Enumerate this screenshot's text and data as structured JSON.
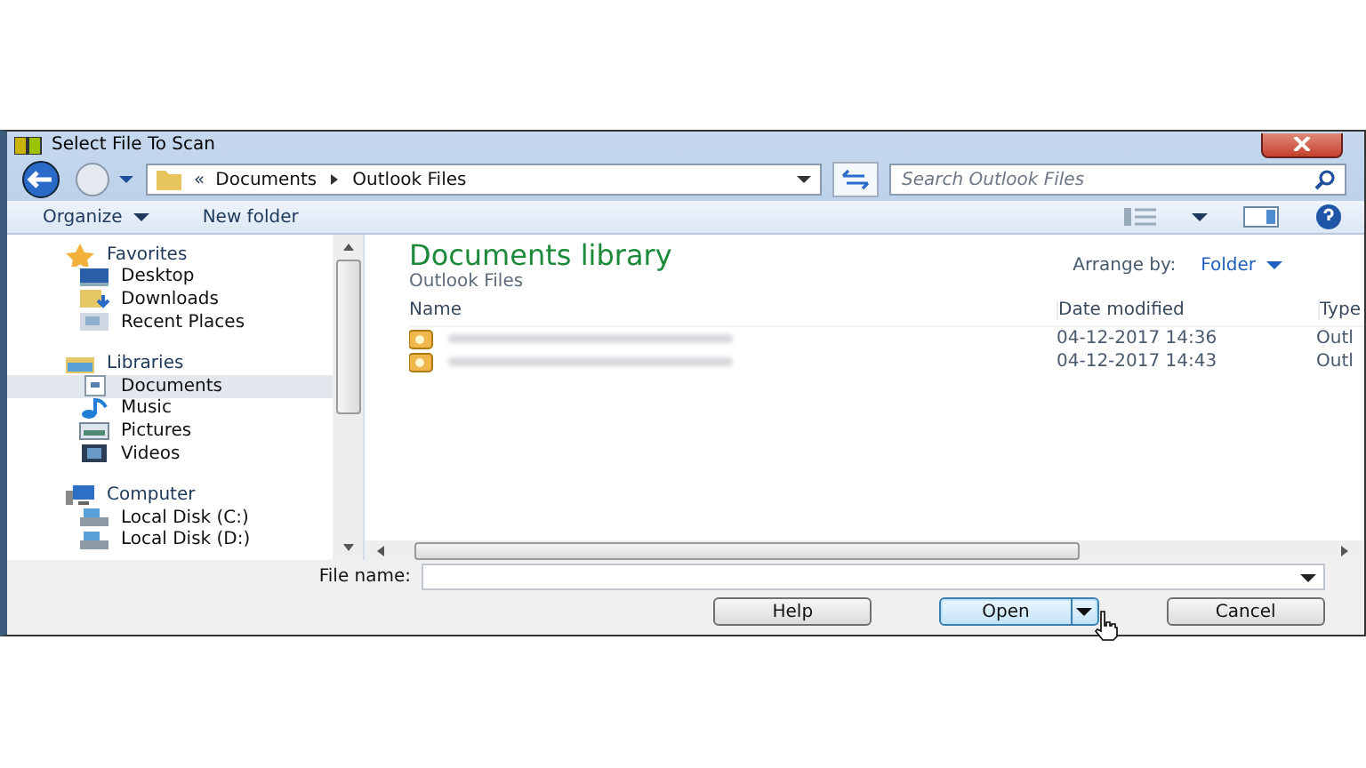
{
  "window": {
    "title": "Select File To Scan"
  },
  "address_bar": {
    "overflow": "«",
    "path": [
      {
        "label": "Documents"
      },
      {
        "label": "Outlook Files"
      }
    ]
  },
  "search": {
    "placeholder": "Search Outlook Files"
  },
  "toolbar": {
    "buttons": [
      {
        "label": "Organize",
        "kind": "menu"
      },
      {
        "label": "New folder",
        "kind": "plain"
      }
    ]
  },
  "sidebar": {
    "groups": [
      {
        "label": "Favorites",
        "kind": "star",
        "children": [
          {
            "label": "Desktop",
            "kind": "desktop",
            "selected": false
          },
          {
            "label": "Downloads",
            "kind": "download",
            "selected": false
          },
          {
            "label": "Recent Places",
            "kind": "recent",
            "selected": false
          }
        ]
      },
      {
        "label": "Libraries",
        "kind": "library",
        "children": [
          {
            "label": "Documents",
            "kind": "document",
            "selected": true
          },
          {
            "label": "Music",
            "kind": "music",
            "selected": false
          },
          {
            "label": "Pictures",
            "kind": "pictures",
            "selected": false
          },
          {
            "label": "Videos",
            "kind": "video",
            "selected": false
          }
        ]
      },
      {
        "label": "Computer",
        "kind": "computer",
        "children": [
          {
            "label": "Local Disk (C:)",
            "kind": "disk",
            "selected": false
          },
          {
            "label": "Local Disk (D:)",
            "kind": "disk",
            "selected": false
          }
        ]
      }
    ]
  },
  "library": {
    "title": "Documents library",
    "subtitle": "Outlook Files",
    "arrange_label": "Arrange by:",
    "arrange_value": "Folder"
  },
  "table": {
    "columns": [
      "Name",
      "Date modified",
      "Type"
    ],
    "rows": [
      {
        "date": "04-12-2017 14:36",
        "type": "Outl"
      },
      {
        "date": "04-12-2017 14:43",
        "type": "Outl"
      }
    ]
  },
  "file_name": {
    "label": "File name:"
  },
  "buttons": [
    {
      "label": "Help",
      "kind": "plain"
    },
    {
      "label": "Open",
      "kind": "split"
    },
    {
      "label": "Cancel",
      "kind": "plain"
    }
  ]
}
